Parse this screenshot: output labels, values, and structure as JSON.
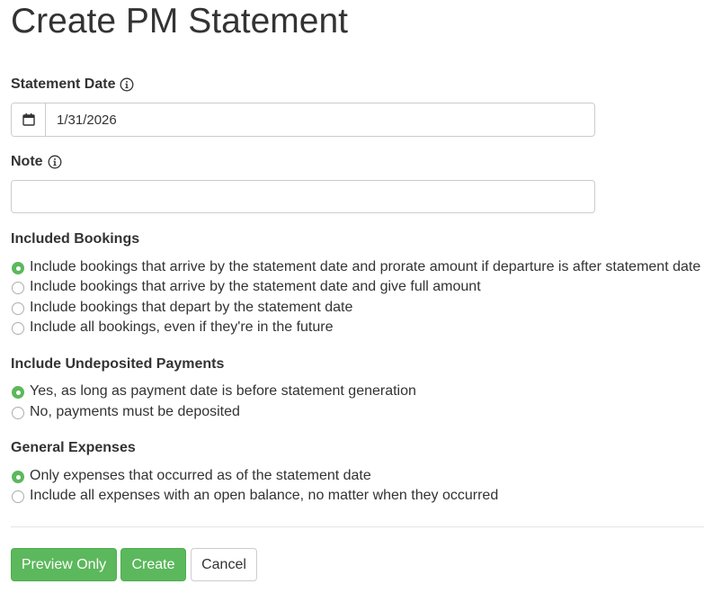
{
  "page": {
    "title": "Create PM Statement"
  },
  "statement_date": {
    "label": "Statement Date",
    "value": "1/31/2026",
    "calendar_icon": "calendar-icon",
    "info_icon": "info-icon"
  },
  "note": {
    "label": "Note",
    "value": "",
    "placeholder": "",
    "info_icon": "info-icon"
  },
  "included_bookings": {
    "heading": "Included Bookings",
    "options": [
      {
        "label": "Include bookings that arrive by the statement date and prorate amount if departure is after statement date",
        "checked": true
      },
      {
        "label": "Include bookings that arrive by the statement date and give full amount",
        "checked": false
      },
      {
        "label": "Include bookings that depart by the statement date",
        "checked": false
      },
      {
        "label": "Include all bookings, even if they're in the future",
        "checked": false
      }
    ]
  },
  "undeposited_payments": {
    "heading": "Include Undeposited Payments",
    "options": [
      {
        "label": "Yes, as long as payment date is before statement generation",
        "checked": true
      },
      {
        "label": "No, payments must be deposited",
        "checked": false
      }
    ]
  },
  "general_expenses": {
    "heading": "General Expenses",
    "options": [
      {
        "label": "Only expenses that occurred as of the statement date",
        "checked": true
      },
      {
        "label": "Include all expenses with an open balance, no matter when they occurred",
        "checked": false
      }
    ]
  },
  "buttons": {
    "preview_label": "Preview Only",
    "create_label": "Create",
    "cancel_label": "Cancel"
  },
  "colors": {
    "primary_green": "#5cb85c",
    "text": "#333333",
    "border": "#cccccc"
  }
}
